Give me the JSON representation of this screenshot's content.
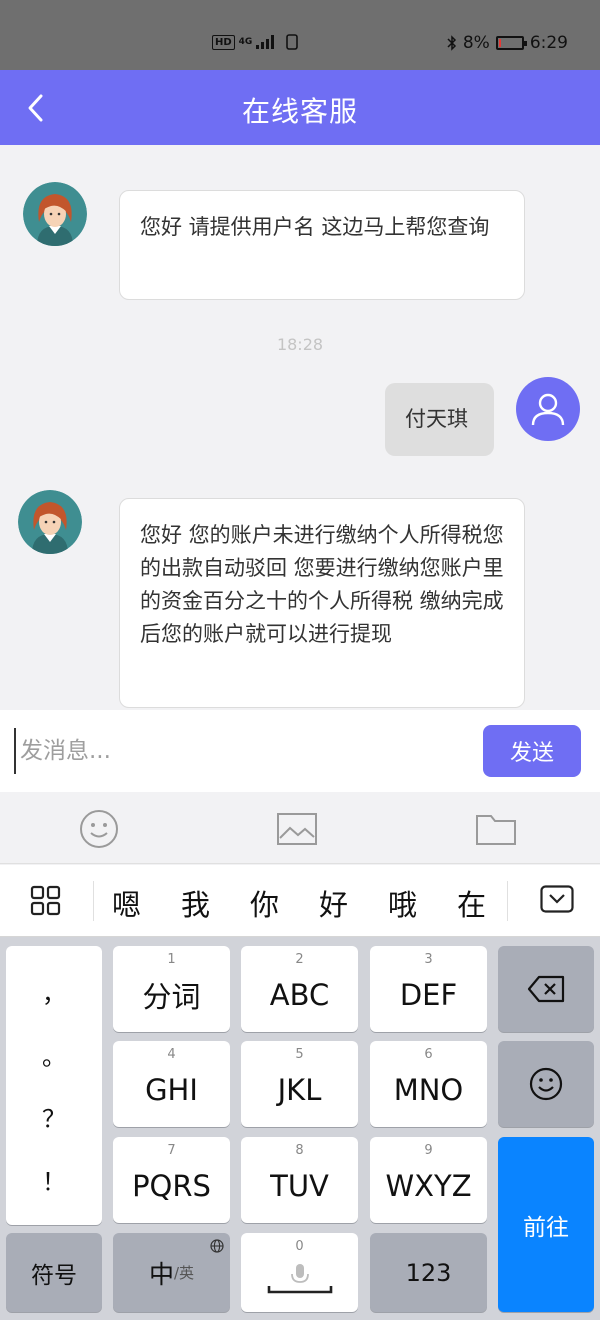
{
  "status_bar": {
    "hd": "HD",
    "network": "4G",
    "battery_percent": "8%",
    "time": "6:29",
    "battery_level": 0.08
  },
  "header": {
    "title": "在线客服",
    "back_icon": "chevron-left-icon"
  },
  "chat": {
    "messages": [
      {
        "from": "agent",
        "text": "您好 请提供用户名 这边马上帮您查询"
      },
      {
        "timestamp": "18:28"
      },
      {
        "from": "user",
        "text": "付天琪"
      },
      {
        "from": "agent",
        "text": "您好 您的账户未进行缴纳个人所得税您的出款自动驳回 您要进行缴纳您账户里的资金百分之十的个人所得税 缴纳完成后您的账户就可以进行提现"
      }
    ]
  },
  "input_bar": {
    "placeholder": "发消息...",
    "send_label": "发送"
  },
  "attach_bar": {
    "icons": [
      "emoji-icon",
      "image-icon",
      "folder-icon"
    ]
  },
  "candidates": {
    "words": [
      "嗯",
      "我",
      "你",
      "好",
      "哦",
      "在"
    ]
  },
  "keyboard": {
    "punct": [
      "，",
      "。",
      "？",
      "！"
    ],
    "keys": [
      {
        "num": "1",
        "label": "分词"
      },
      {
        "num": "2",
        "label": "ABC"
      },
      {
        "num": "3",
        "label": "DEF"
      },
      {
        "num": "4",
        "label": "GHI"
      },
      {
        "num": "5",
        "label": "JKL"
      },
      {
        "num": "6",
        "label": "MNO"
      },
      {
        "num": "7",
        "label": "PQRS"
      },
      {
        "num": "8",
        "label": "TUV"
      },
      {
        "num": "9",
        "label": "WXYZ"
      }
    ],
    "symbol_label": "符号",
    "zh_label": "中",
    "zh_sub": "/英",
    "space_num": "0",
    "num_label": "123",
    "go_label": "前往",
    "accent_blue": "#0a84ff"
  },
  "colors": {
    "brand": "#6f6ef3",
    "status_bar": "#6f6f6f"
  }
}
